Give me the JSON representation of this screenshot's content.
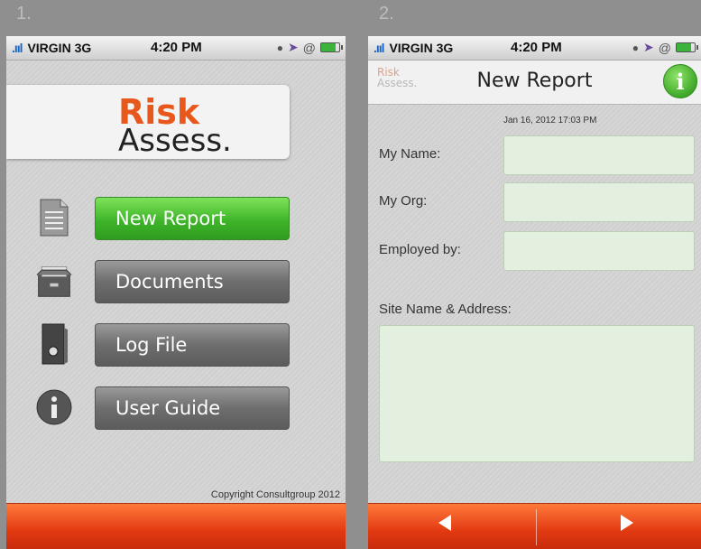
{
  "steps": [
    "1.",
    "2."
  ],
  "status": {
    "carrier": "VIRGIN",
    "network": "3G",
    "time": "4:20 PM"
  },
  "home": {
    "logo_top": "Risk",
    "logo_bottom": "Assess.",
    "menu": [
      {
        "label": "New Report",
        "icon": "document-icon",
        "color": "#3fb52a"
      },
      {
        "label": "Documents",
        "icon": "file-drawer-icon"
      },
      {
        "label": "Log File",
        "icon": "binder-icon"
      },
      {
        "label": "User Guide",
        "icon": "info-circle-icon"
      }
    ],
    "copyright": "Copyright Consultgroup 2012"
  },
  "report": {
    "nav_logo_top": "Risk",
    "nav_logo_bottom": "Assess.",
    "title": "New Report",
    "date": "Jan 16, 2012 17:03 PM",
    "fields": [
      {
        "label": "My Name:",
        "value": ""
      },
      {
        "label": "My Org:",
        "value": ""
      },
      {
        "label": "Employed by:",
        "value": ""
      }
    ],
    "address_label": "Site Name & Address:",
    "address_value": ""
  },
  "colors": {
    "accent_orange": "#e8581c",
    "accent_green": "#3fb52a",
    "field_bg": "#e4f0df"
  }
}
